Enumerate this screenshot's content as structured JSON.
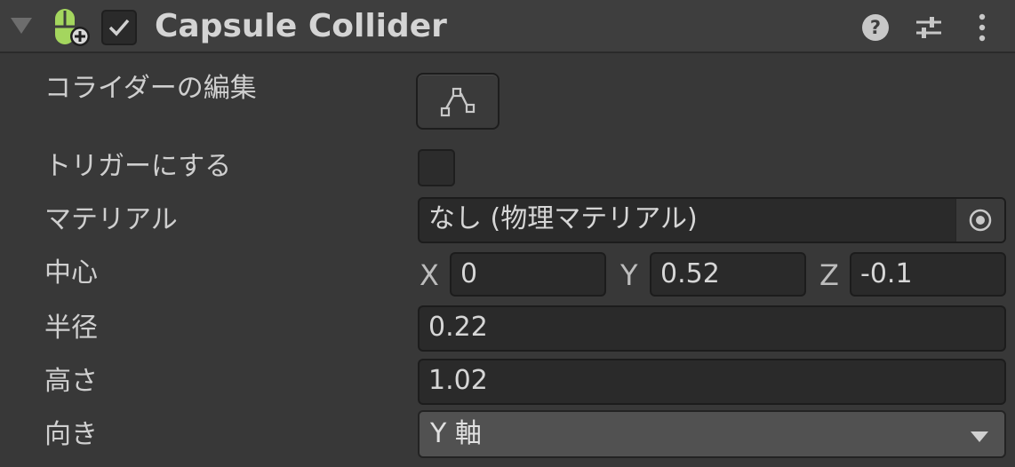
{
  "header": {
    "title": "Capsule Collider",
    "enabled": true,
    "icons": [
      "foldout-arrow-icon",
      "capsule-collider-icon",
      "checkmark-icon",
      "help-icon",
      "presets-icon",
      "more-options-icon"
    ]
  },
  "fields": {
    "edit_collider_label": "コライダーの編集",
    "is_trigger_label": "トリガーにする",
    "material_label": "マテリアル",
    "material_value": "なし (物理マテリアル)",
    "center_label": "中心",
    "center": {
      "x_label": "X",
      "x": "0",
      "y_label": "Y",
      "y": "0.52",
      "z_label": "Z",
      "z": "-0.1"
    },
    "radius_label": "半径",
    "radius": "0.22",
    "height_label": "高さ",
    "height": "1.02",
    "direction_label": "向き",
    "direction": "Y 軸"
  },
  "colors": {
    "background": "#383838",
    "header": "#3e3e3e",
    "field": "#2a2a2a",
    "icon_green": "#a4d65e"
  }
}
